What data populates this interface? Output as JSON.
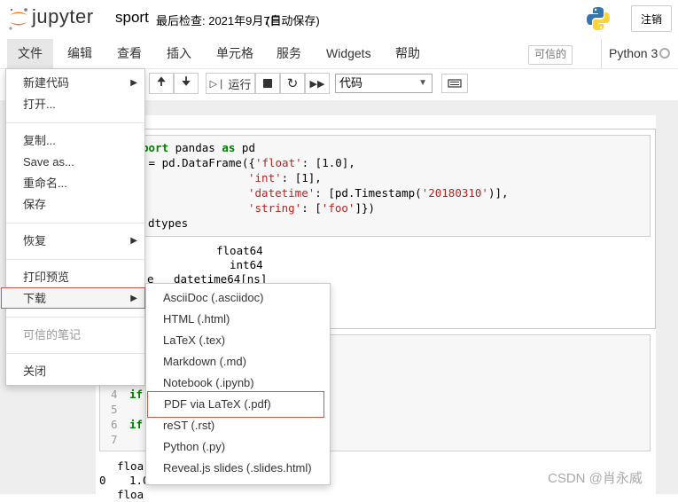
{
  "header": {
    "logo_text": "jupyter",
    "notebook_name": "sport",
    "checkpoint": "最后检查: 2021年9月7日",
    "autosave": "(自动保存)",
    "logout_label": "注销"
  },
  "menubar": {
    "items": [
      "文件",
      "编辑",
      "查看",
      "插入",
      "单元格",
      "服务",
      "Widgets",
      "帮助"
    ],
    "trusted_label": "可信的",
    "kernel_name": "Python 3"
  },
  "toolbar": {
    "run_label": "运行",
    "cell_type": "代码"
  },
  "file_menu": {
    "items": [
      "新建代码",
      "打开...",
      "复制...",
      "Save as...",
      "重命名...",
      "保存",
      "恢复",
      "打印预览",
      "下载",
      "可信的笔记",
      "关闭"
    ]
  },
  "download_menu": {
    "items": [
      "AsciiDoc (.asciidoc)",
      "HTML (.html)",
      "LaTeX (.tex)",
      "Markdown (.md)",
      "Notebook (.ipynb)",
      "PDF via LaTeX (.pdf)",
      "reST (.rst)",
      "Python (.py)",
      "Reveal.js slides (.slides.html)"
    ]
  },
  "cell1": {
    "line1_kw": "port",
    "line1_rest": " pandas ",
    "line1_as": "as",
    "line1_end": " pd",
    "line2": " = pd.DataFrame({",
    "k_float": "'float'",
    "v_float": ": [1.0],",
    "k_int": "'int'",
    "v_int": ": [1],",
    "k_datetime": "'datetime'",
    "v_datetime_a": ": [pd.Timestamp(",
    "v_datetime_b": "'20180310'",
    "v_datetime_c": ")],",
    "k_string": "'string'",
    "v_string_a": ": [",
    "v_string_b": "'foo'",
    "v_string_c": "]})",
    "line_dtypes": "dtypes"
  },
  "output1": {
    "row1": "float64",
    "row2": "int64",
    "row3_left": "e",
    "row3_right": "datetime64[ns]"
  },
  "cell2": {
    "ln4": "4",
    "ln5": "5",
    "ln6": "6",
    "ln7": "7",
    "if1": "if",
    "if2": "if"
  },
  "output2": {
    "row1": "floa",
    "row2_idx": "0",
    "row2_val": "1.0",
    "row3": "floa"
  },
  "watermark": "CSDN @肖永威"
}
